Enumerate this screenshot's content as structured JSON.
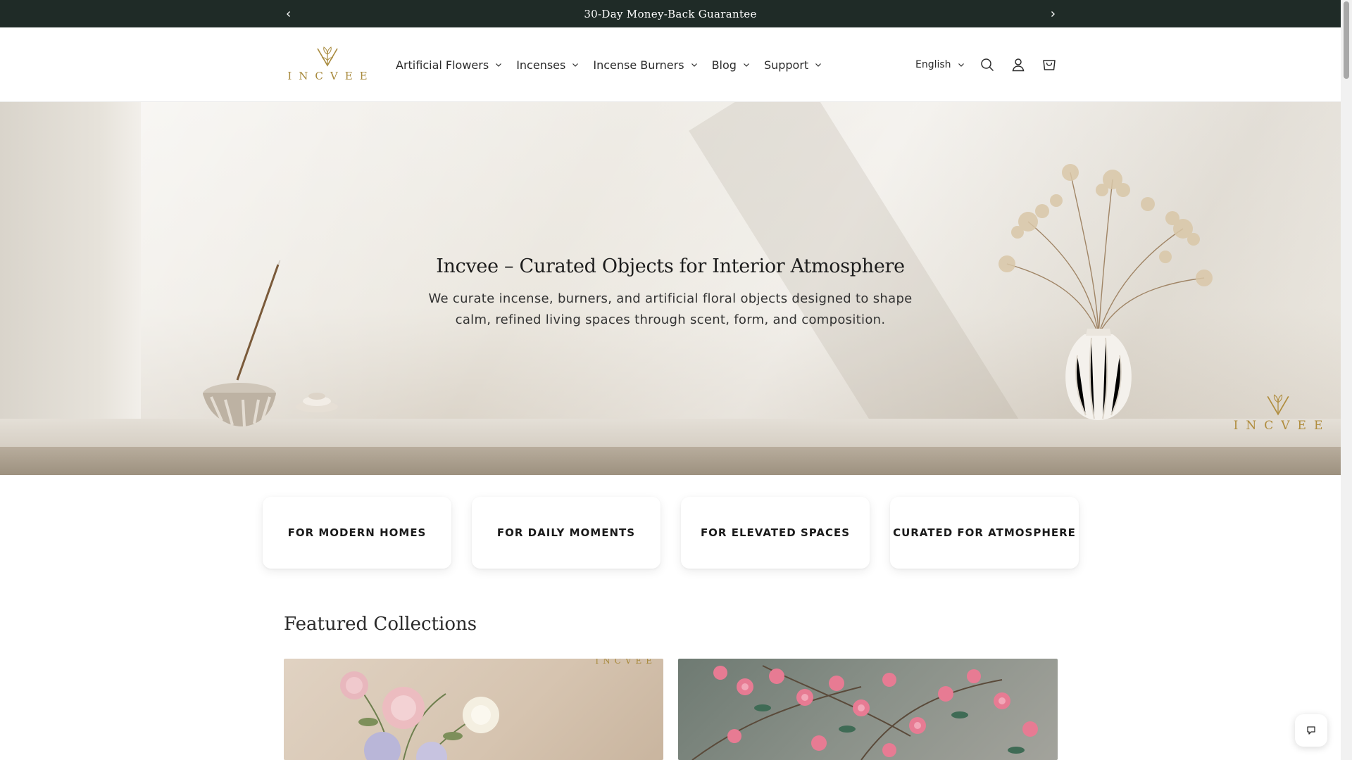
{
  "announcement": {
    "text": "30-Day Money-Back Guarantee",
    "prev_icon": "chevron-left-icon",
    "next_icon": "chevron-right-icon"
  },
  "header": {
    "logo_text": "INCVEE",
    "nav": [
      {
        "label": "Artificial Flowers"
      },
      {
        "label": "Incenses"
      },
      {
        "label": "Incense Burners"
      },
      {
        "label": "Blog"
      },
      {
        "label": "Support"
      }
    ],
    "language": "English",
    "icons": [
      "search-icon",
      "account-icon",
      "cart-icon"
    ]
  },
  "hero": {
    "title": "Incvee – Curated Objects for Interior Atmosphere",
    "subtitle": "We curate incense, burners, and artificial floral objects designed to shape calm, refined living spaces through scent, form, and composition.",
    "watermark": "INCVEE"
  },
  "features": [
    {
      "label": "FOR MODERN HOMES"
    },
    {
      "label": "FOR DAILY MOMENTS"
    },
    {
      "label": "FOR ELEVATED SPACES"
    },
    {
      "label": "CURATED FOR ATMOSPHERE"
    }
  ],
  "featured": {
    "title": "Featured Collections",
    "cards": [
      {
        "tag": "INCVEE"
      },
      {
        "tag": ""
      }
    ]
  },
  "colors": {
    "announcement_bg": "#1f2b27",
    "brand_gold": "#a88a3d"
  }
}
